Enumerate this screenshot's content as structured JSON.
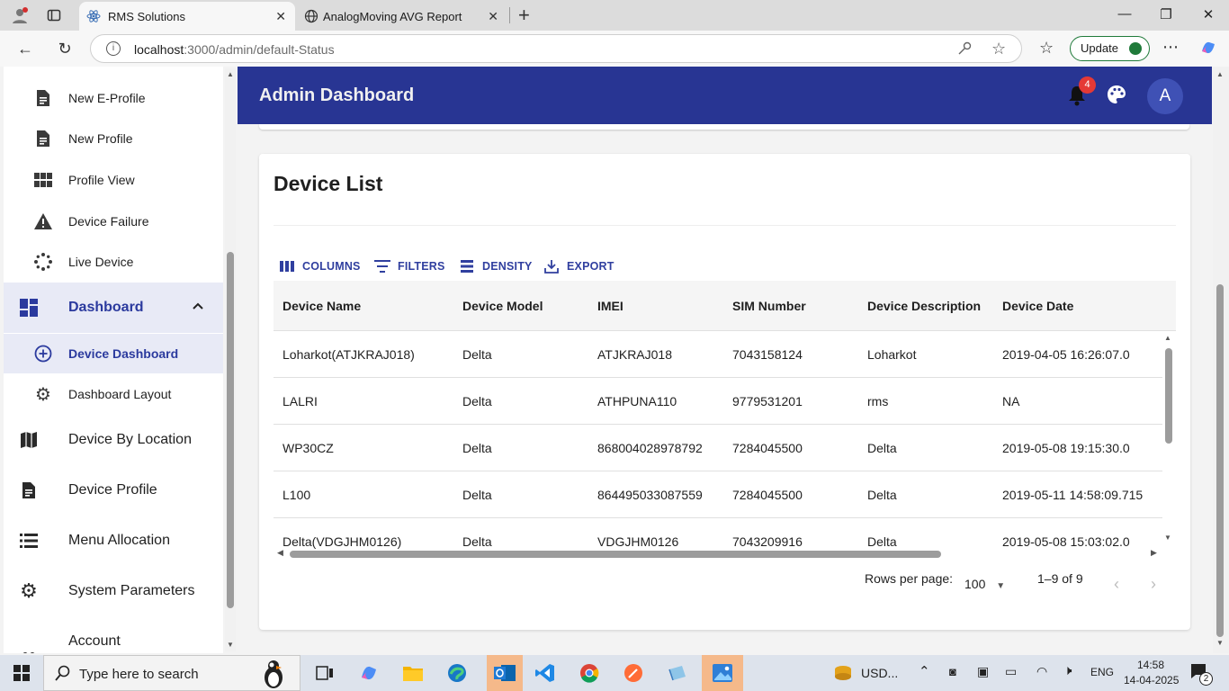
{
  "browser": {
    "tabs": [
      {
        "label": "RMS Solutions",
        "active": true
      },
      {
        "label": "AnalogMoving AVG Report",
        "active": false
      }
    ],
    "url_host": "localhost",
    "url_rest": ":3000/admin/default-Status",
    "update_label": "Update"
  },
  "sidebar": {
    "items": [
      {
        "label": "New E-Profile",
        "icon": "document-icon"
      },
      {
        "label": "New Profile",
        "icon": "document-icon"
      },
      {
        "label": "Profile View",
        "icon": "grid-view-icon"
      },
      {
        "label": "Device Failure",
        "icon": "warning-icon"
      },
      {
        "label": "Live Device",
        "icon": "loader-icon"
      }
    ],
    "group": {
      "label": "Dashboard",
      "icon": "dashboard-icon",
      "expanded": true
    },
    "sub_items": [
      {
        "label": "Device Dashboard",
        "icon": "add-circle-icon",
        "selected": true
      },
      {
        "label": "Dashboard Layout",
        "icon": "gear-icon",
        "selected": false
      }
    ],
    "bottom_items": [
      {
        "label": "Device By Location",
        "icon": "map-icon"
      },
      {
        "label": "Device Profile",
        "icon": "document-icon"
      },
      {
        "label": "Menu Allocation",
        "icon": "list-icon"
      },
      {
        "label": "System Parameters",
        "icon": "gear-icon"
      },
      {
        "label": "Account",
        "icon": "people-icon"
      }
    ]
  },
  "appbar": {
    "title": "Admin Dashboard",
    "notification_count": "4",
    "avatar_letter": "A",
    "color": "#283593"
  },
  "card": {
    "title": "Device List",
    "toolbar": {
      "columns": "COLUMNS",
      "filters": "FILTERS",
      "density": "DENSITY",
      "export": "EXPORT"
    },
    "columns": [
      "Device Name",
      "Device Model",
      "IMEI",
      "SIM Number",
      "Device Description",
      "Device Date"
    ],
    "rows": [
      [
        "Loharkot(ATJKRAJ018)",
        "Delta",
        "ATJKRAJ018",
        "7043158124",
        "Loharkot",
        "2019-04-05 16:26:07.0"
      ],
      [
        "LALRI",
        "Delta",
        "ATHPUNA110",
        "9779531201",
        "rms",
        "NA"
      ],
      [
        "WP30CZ",
        "Delta",
        "868004028978792",
        "7284045500",
        "Delta",
        "2019-05-08 19:15:30.0"
      ],
      [
        "L100",
        "Delta",
        "864495033087559",
        "7284045500",
        "Delta",
        "2019-05-11 14:58:09.715"
      ],
      [
        "Delta(VDGJHM0126)",
        "Delta",
        "VDGJHM0126",
        "7043209916",
        "Delta",
        "2019-05-08 15:03:02.0"
      ]
    ],
    "pagination": {
      "rows_per_page_label": "Rows per page:",
      "rows_per_page_value": "100",
      "range": "1–9 of 9"
    }
  },
  "taskbar": {
    "search_placeholder": "Type here to search",
    "currency": "USD...",
    "language": "ENG",
    "time": "14:58",
    "date": "14-04-2025",
    "notification_count": "2"
  }
}
